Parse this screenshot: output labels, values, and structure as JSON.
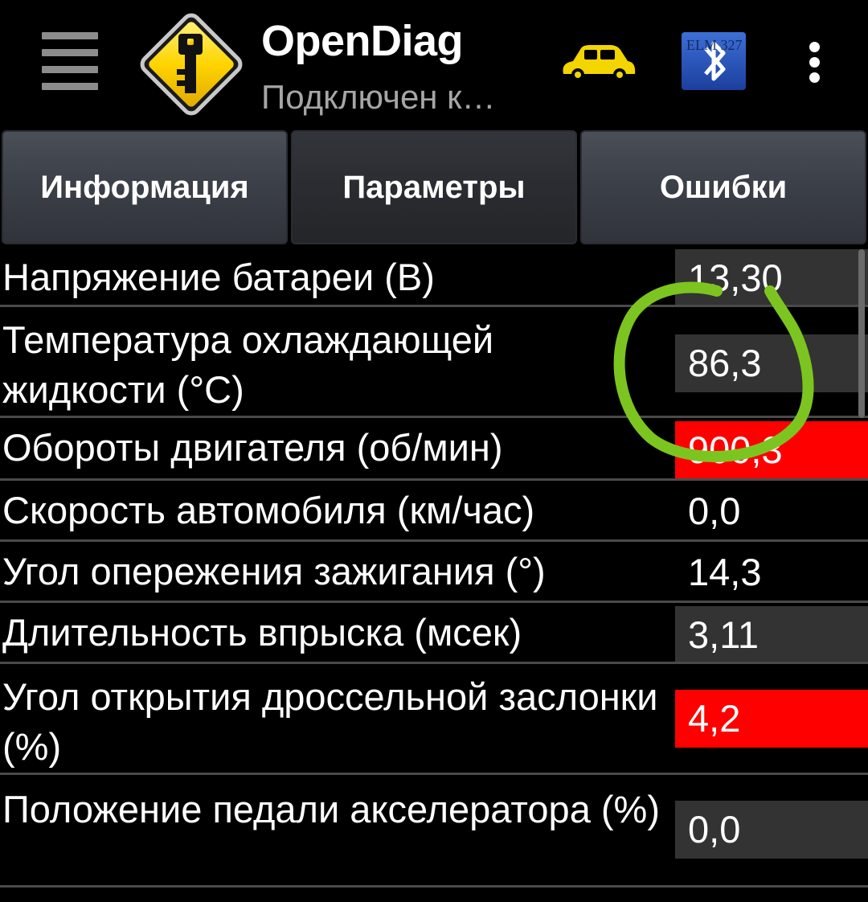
{
  "app": {
    "title": "OpenDiag",
    "subtitle": "Подключен к…",
    "icons": {
      "menu": "hamburger-menu-icon",
      "app": "warning-key-icon",
      "car": "car-icon",
      "bluetooth": "bluetooth-elm327-icon",
      "overflow": "more-vert-icon"
    },
    "bt_badge_text": "ELM 327"
  },
  "tabs": [
    {
      "label": "Информация",
      "active": false
    },
    {
      "label": "Параметры",
      "active": true
    },
    {
      "label": "Ошибки",
      "active": false
    }
  ],
  "parameters": [
    {
      "label": "Напряжение батареи (В)",
      "value": "13,30",
      "highlight": "gray"
    },
    {
      "label": "Температура охлаждающей жидкости (°C)",
      "value": "86,3",
      "highlight": "gray"
    },
    {
      "label": "Обороты двигателя (об/мин)",
      "value": "900,3",
      "highlight": "red"
    },
    {
      "label": "Скорость автомобиля (км/час)",
      "value": "0,0",
      "highlight": "none"
    },
    {
      "label": "Угол опережения зажигания (°)",
      "value": "14,3",
      "highlight": "none"
    },
    {
      "label": "Длительность впрыска (мсек)",
      "value": "3,11",
      "highlight": "gray"
    },
    {
      "label": "Угол открытия дроссельной заслонки (%)",
      "value": "4,2",
      "highlight": "red"
    },
    {
      "label": "Положение педали акселератора (%)",
      "value": "0,0",
      "highlight": "gray"
    }
  ],
  "colors": {
    "background": "#000000",
    "highlight_red": "#ff0000",
    "highlight_gray": "#333333",
    "annotation_green": "#7cc520",
    "car_yellow": "#f3d500"
  }
}
